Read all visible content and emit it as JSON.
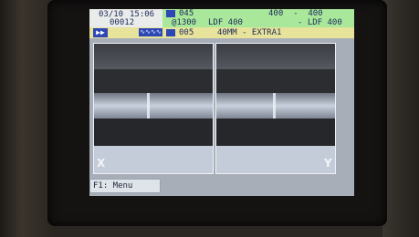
{
  "status": {
    "date": "03/10",
    "time": "15:06",
    "counter": "00012",
    "fiber_count": "045",
    "range_top": "400  -  400",
    "wavelength": "@1300",
    "ldf_left": "LDF 400",
    "ldf_right": "- LDF 400",
    "program_num": "005",
    "program_name": "40MM - EXTRA1",
    "mode_icon": "play-forward",
    "wave_icon": "wave"
  },
  "views": {
    "left_label": "X",
    "right_label": "Y"
  },
  "footer": {
    "menu_label": "F1: Menu"
  },
  "colors": {
    "header_green": "#a9e89a",
    "header_yellow": "#e8e39a",
    "icon_blue": "#2d47b5"
  }
}
